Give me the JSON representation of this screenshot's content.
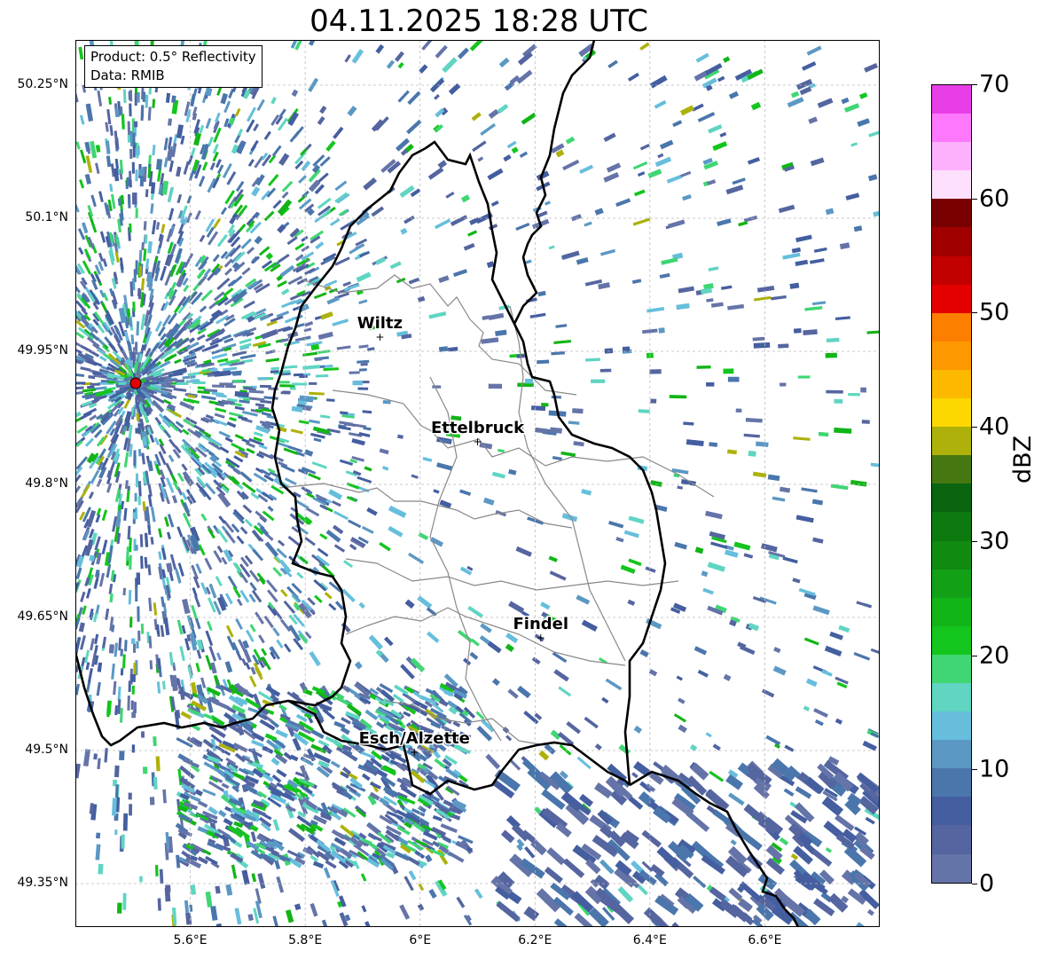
{
  "title": "04.11.2025 18:28 UTC",
  "info": {
    "product": "Product: 0.5° Reflectivity",
    "data": "Data: RMIB"
  },
  "axes": {
    "lat_ticks": [
      "50.25°N",
      "50.1°N",
      "49.95°N",
      "49.8°N",
      "49.65°N",
      "49.5°N",
      "49.35°N"
    ],
    "lon_ticks": [
      "5.6°E",
      "5.8°E",
      "6°E",
      "6.2°E",
      "6.4°E",
      "6.6°E"
    ],
    "lon_range": [
      5.4,
      6.8
    ],
    "lat_range": [
      49.3,
      50.3
    ]
  },
  "cities": [
    {
      "name": "Wiltz",
      "lon": 5.93,
      "lat": 49.966
    },
    {
      "name": "Ettelbruck",
      "lon": 6.1,
      "lat": 49.848
    },
    {
      "name": "Findel",
      "lon": 6.21,
      "lat": 49.627
    },
    {
      "name": "Esch/Alzette",
      "lon": 5.99,
      "lat": 49.498
    }
  ],
  "radar_site": {
    "lon": 5.505,
    "lat": 49.914
  },
  "colorbar": {
    "label": "dBZ",
    "ticks": [
      "0",
      "10",
      "20",
      "30",
      "40",
      "50",
      "60",
      "70"
    ],
    "min": 0,
    "max": 70,
    "colors": [
      "#6574a8",
      "#5565a0",
      "#445ea0",
      "#4a76ac",
      "#5b98c4",
      "#66bedc",
      "#5fd5c2",
      "#3fd673",
      "#14c51d",
      "#12b517",
      "#12a016",
      "#118a12",
      "#0d7a10",
      "#0a6410",
      "#467812",
      "#adb10a",
      "#fdd700",
      "#fdb900",
      "#fd9800",
      "#fd7f00",
      "#e50000",
      "#c20000",
      "#a00000",
      "#780000",
      "#fde0fd",
      "#fdb1fd",
      "#fd78fd",
      "#e83ee8"
    ]
  },
  "chart_data": {
    "type": "heatmap",
    "title": "04.11.2025 18:28 UTC",
    "colorbar_label": "dBZ",
    "colorbar_range": [
      0,
      70
    ],
    "x_ticks": [
      "5.6°E",
      "5.8°E",
      "6°E",
      "6.2°E",
      "6.4°E",
      "6.6°E"
    ],
    "y_ticks": [
      "50.25°N",
      "50.1°N",
      "49.95°N",
      "49.8°N",
      "49.65°N",
      "49.5°N",
      "49.35°N"
    ],
    "grid": true
  }
}
